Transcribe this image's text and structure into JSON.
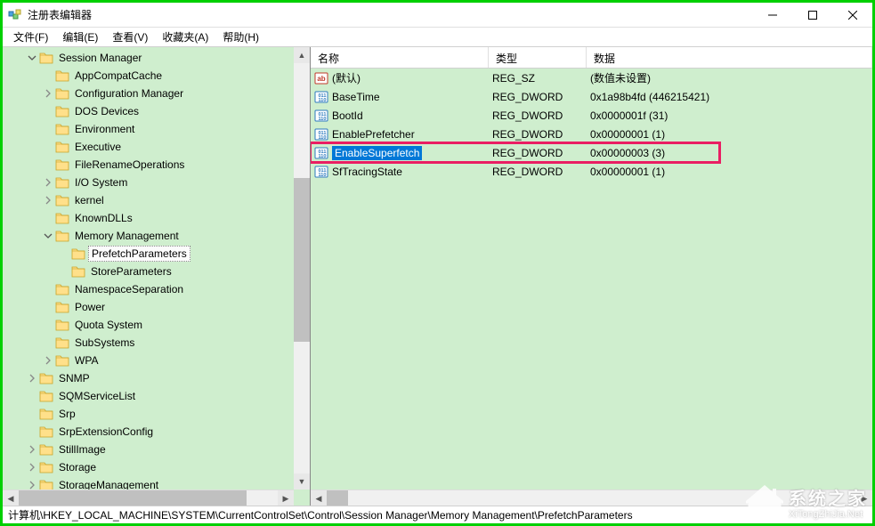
{
  "window": {
    "title": "注册表编辑器"
  },
  "menu": {
    "file": "文件(F)",
    "edit": "编辑(E)",
    "view": "查看(V)",
    "favorites": "收藏夹(A)",
    "help": "帮助(H)"
  },
  "tree": [
    {
      "depth": 1,
      "expander": "open",
      "label": "Session Manager",
      "selected": false
    },
    {
      "depth": 2,
      "expander": "none",
      "label": "AppCompatCache",
      "selected": false
    },
    {
      "depth": 2,
      "expander": "closed",
      "label": "Configuration Manager",
      "selected": false
    },
    {
      "depth": 2,
      "expander": "none",
      "label": "DOS Devices",
      "selected": false
    },
    {
      "depth": 2,
      "expander": "none",
      "label": "Environment",
      "selected": false
    },
    {
      "depth": 2,
      "expander": "none",
      "label": "Executive",
      "selected": false
    },
    {
      "depth": 2,
      "expander": "none",
      "label": "FileRenameOperations",
      "selected": false
    },
    {
      "depth": 2,
      "expander": "closed",
      "label": "I/O System",
      "selected": false
    },
    {
      "depth": 2,
      "expander": "closed",
      "label": "kernel",
      "selected": false
    },
    {
      "depth": 2,
      "expander": "none",
      "label": "KnownDLLs",
      "selected": false
    },
    {
      "depth": 2,
      "expander": "open",
      "label": "Memory Management",
      "selected": false
    },
    {
      "depth": 3,
      "expander": "none",
      "label": "PrefetchParameters",
      "selected": true
    },
    {
      "depth": 3,
      "expander": "none",
      "label": "StoreParameters",
      "selected": false
    },
    {
      "depth": 2,
      "expander": "none",
      "label": "NamespaceSeparation",
      "selected": false
    },
    {
      "depth": 2,
      "expander": "none",
      "label": "Power",
      "selected": false
    },
    {
      "depth": 2,
      "expander": "none",
      "label": "Quota System",
      "selected": false
    },
    {
      "depth": 2,
      "expander": "none",
      "label": "SubSystems",
      "selected": false
    },
    {
      "depth": 2,
      "expander": "closed",
      "label": "WPA",
      "selected": false
    },
    {
      "depth": 1,
      "expander": "closed",
      "label": "SNMP",
      "selected": false
    },
    {
      "depth": 1,
      "expander": "none",
      "label": "SQMServiceList",
      "selected": false
    },
    {
      "depth": 1,
      "expander": "none",
      "label": "Srp",
      "selected": false
    },
    {
      "depth": 1,
      "expander": "none",
      "label": "SrpExtensionConfig",
      "selected": false
    },
    {
      "depth": 1,
      "expander": "closed",
      "label": "StillImage",
      "selected": false
    },
    {
      "depth": 1,
      "expander": "closed",
      "label": "Storage",
      "selected": false
    },
    {
      "depth": 1,
      "expander": "closed",
      "label": "StorageManagement",
      "selected": false
    }
  ],
  "list": {
    "headers": {
      "name": "名称",
      "type": "类型",
      "data": "数据"
    },
    "rows": [
      {
        "icon": "string",
        "name": "(默认)",
        "type": "REG_SZ",
        "data": "(数值未设置)",
        "selected": false,
        "highlighted": false
      },
      {
        "icon": "dword",
        "name": "BaseTime",
        "type": "REG_DWORD",
        "data": "0x1a98b4fd (446215421)",
        "selected": false,
        "highlighted": false
      },
      {
        "icon": "dword",
        "name": "BootId",
        "type": "REG_DWORD",
        "data": "0x0000001f (31)",
        "selected": false,
        "highlighted": false
      },
      {
        "icon": "dword",
        "name": "EnablePrefetcher",
        "type": "REG_DWORD",
        "data": "0x00000001 (1)",
        "selected": false,
        "highlighted": false
      },
      {
        "icon": "dword",
        "name": "EnableSuperfetch",
        "type": "REG_DWORD",
        "data": "0x00000003 (3)",
        "selected": true,
        "highlighted": true
      },
      {
        "icon": "dword",
        "name": "SfTracingState",
        "type": "REG_DWORD",
        "data": "0x00000001 (1)",
        "selected": false,
        "highlighted": false
      }
    ]
  },
  "statusbar": "计算机\\HKEY_LOCAL_MACHINE\\SYSTEM\\CurrentControlSet\\Control\\Session Manager\\Memory Management\\PrefetchParameters",
  "watermark": {
    "cn": "系统之家",
    "url": "XiTongZhiJia.Net"
  }
}
